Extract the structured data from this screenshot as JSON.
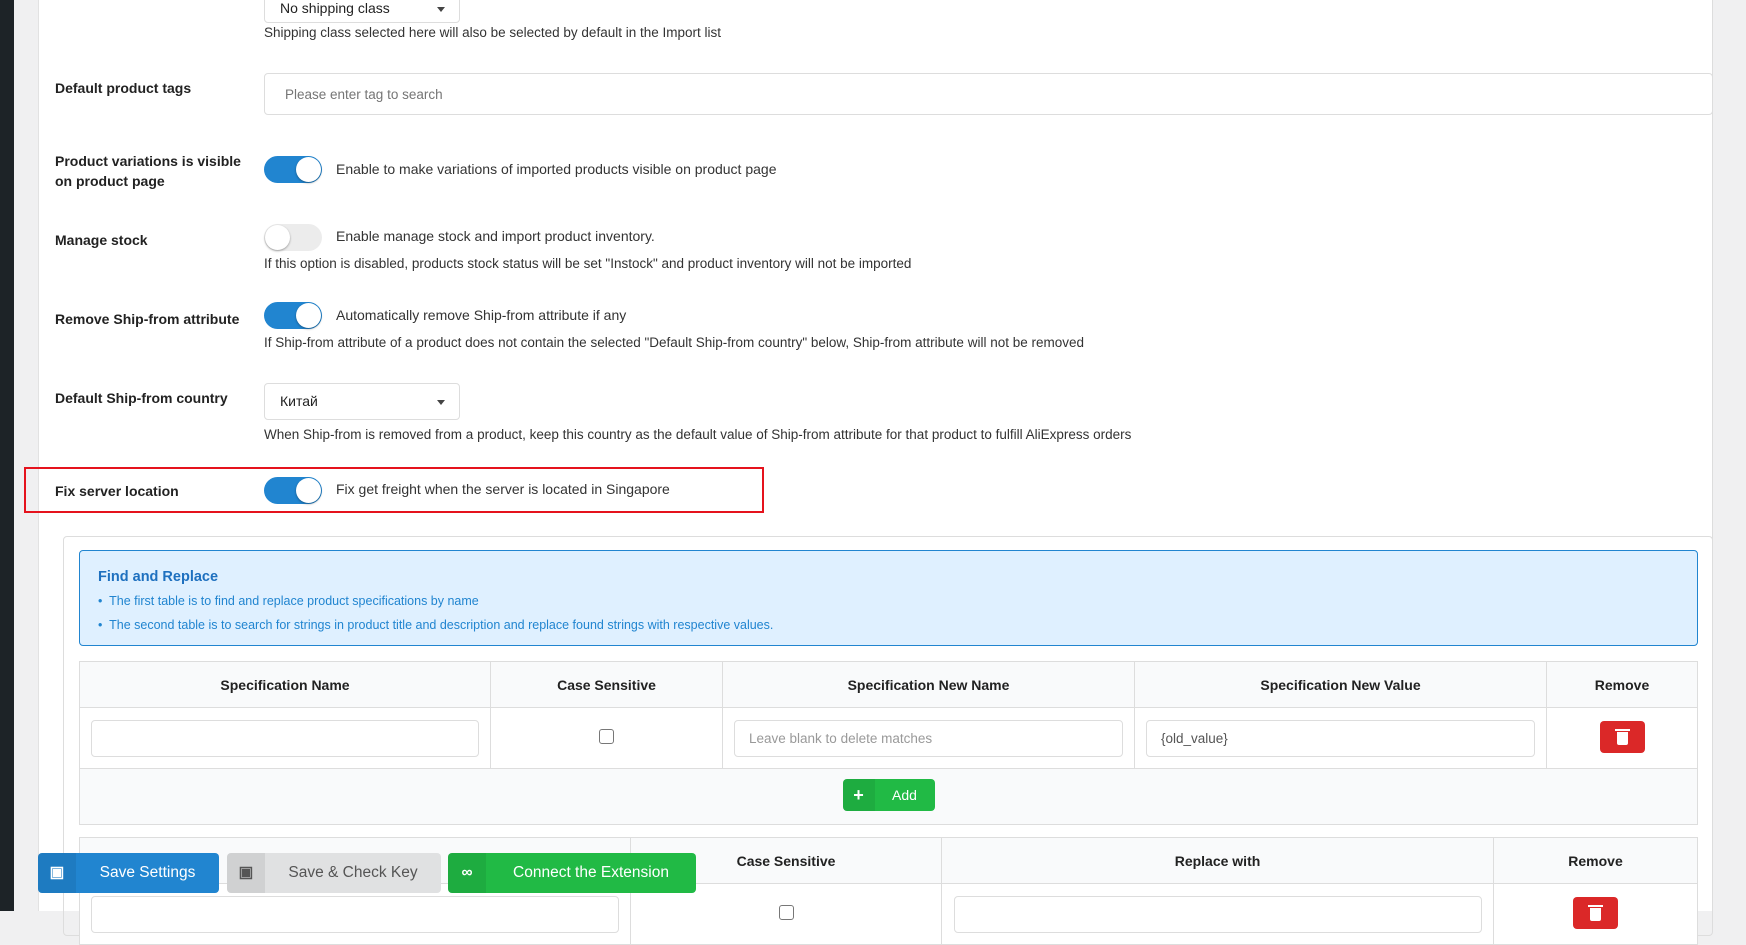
{
  "settings": {
    "shipping_class": {
      "value": "No shipping class",
      "help": "Shipping class selected here will also be selected by default in the Import list"
    },
    "tags": {
      "label": "Default product tags",
      "placeholder": "Please enter tag to search"
    },
    "variations": {
      "label": "Product variations is visible on product page",
      "toggle_label": "Enable to make variations of imported products visible on product page",
      "enabled": true
    },
    "manage_stock": {
      "label": "Manage stock",
      "toggle_label": "Enable manage stock and import product inventory.",
      "help": "If this option is disabled, products stock status will be set \"Instock\" and product inventory will not be imported",
      "enabled": false
    },
    "remove_ship_from": {
      "label": "Remove Ship-from attribute",
      "toggle_label": "Automatically remove Ship-from attribute if any",
      "help": "If Ship-from attribute of a product does not contain the selected \"Default Ship-from country\" below, Ship-from attribute will not be removed",
      "enabled": true
    },
    "default_ship_from": {
      "label": "Default Ship-from country",
      "value": "Китай",
      "help": "When Ship-from is removed from a product, keep this country as the default value of Ship-from attribute for that product to fulfill AliExpress orders"
    },
    "fix_server": {
      "label": "Fix server location",
      "toggle_label": "Fix get freight when the server is located in Singapore",
      "enabled": true
    }
  },
  "find_replace": {
    "title": "Find and Replace",
    "bullets": [
      "The first table is to find and replace product specifications by name",
      "The second table is to search for strings in product title and description and replace found strings with respective values."
    ],
    "table1": {
      "headers": [
        "Specification Name",
        "Case Sensitive",
        "Specification New Name",
        "Specification New Value",
        "Remove"
      ],
      "row": {
        "name": "",
        "new_name_placeholder": "Leave blank to delete matches",
        "new_value": "{old_value}"
      },
      "add_label": "Add"
    },
    "table2": {
      "headers": [
        "",
        "Case Sensitive",
        "Replace with",
        "Remove"
      ]
    }
  },
  "buttons": {
    "save": "Save Settings",
    "save_check": "Save & Check Key",
    "connect": "Connect the Extension"
  },
  "colors": {
    "primary": "#2185d0",
    "danger": "#db2828",
    "success": "#21ba45",
    "highlight": "#e5131d"
  }
}
